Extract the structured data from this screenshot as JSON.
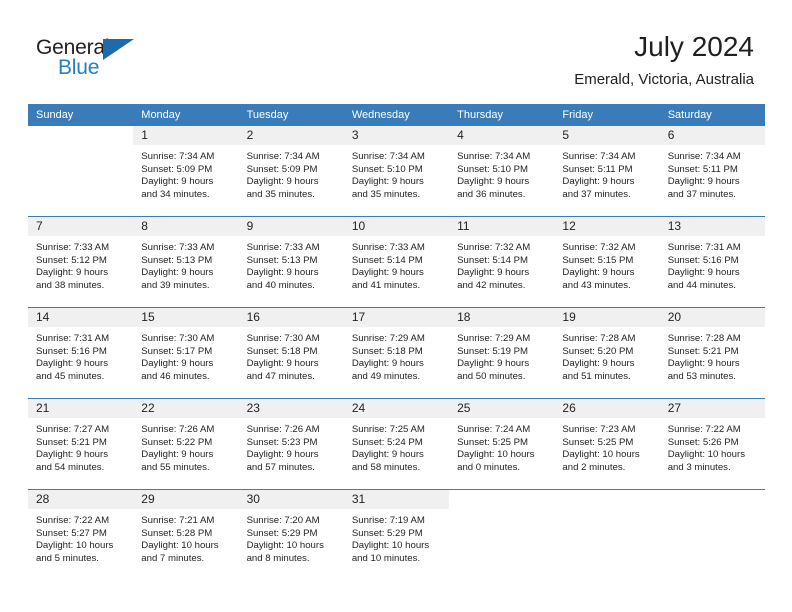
{
  "brand": {
    "name_part1": "General",
    "name_part2": "Blue",
    "triangle_color": "#1c6cad",
    "blue_color": "#2580c3"
  },
  "header": {
    "title": "July 2024",
    "location": "Emerald, Victoria, Australia"
  },
  "theme": {
    "header_bg": "#3a7cba",
    "daynum_bg": "#f0f0f0",
    "text": "#231f20"
  },
  "weekdays": [
    "Sunday",
    "Monday",
    "Tuesday",
    "Wednesday",
    "Thursday",
    "Friday",
    "Saturday"
  ],
  "weeks": [
    [
      {
        "day": "",
        "sunrise": "",
        "sunset": "",
        "daylight_line1": "",
        "daylight_line2": "",
        "blank": true
      },
      {
        "day": "1",
        "sunrise": "Sunrise: 7:34 AM",
        "sunset": "Sunset: 5:09 PM",
        "daylight_line1": "Daylight: 9 hours",
        "daylight_line2": "and 34 minutes."
      },
      {
        "day": "2",
        "sunrise": "Sunrise: 7:34 AM",
        "sunset": "Sunset: 5:09 PM",
        "daylight_line1": "Daylight: 9 hours",
        "daylight_line2": "and 35 minutes."
      },
      {
        "day": "3",
        "sunrise": "Sunrise: 7:34 AM",
        "sunset": "Sunset: 5:10 PM",
        "daylight_line1": "Daylight: 9 hours",
        "daylight_line2": "and 35 minutes."
      },
      {
        "day": "4",
        "sunrise": "Sunrise: 7:34 AM",
        "sunset": "Sunset: 5:10 PM",
        "daylight_line1": "Daylight: 9 hours",
        "daylight_line2": "and 36 minutes."
      },
      {
        "day": "5",
        "sunrise": "Sunrise: 7:34 AM",
        "sunset": "Sunset: 5:11 PM",
        "daylight_line1": "Daylight: 9 hours",
        "daylight_line2": "and 37 minutes."
      },
      {
        "day": "6",
        "sunrise": "Sunrise: 7:34 AM",
        "sunset": "Sunset: 5:11 PM",
        "daylight_line1": "Daylight: 9 hours",
        "daylight_line2": "and 37 minutes."
      }
    ],
    [
      {
        "day": "7",
        "sunrise": "Sunrise: 7:33 AM",
        "sunset": "Sunset: 5:12 PM",
        "daylight_line1": "Daylight: 9 hours",
        "daylight_line2": "and 38 minutes."
      },
      {
        "day": "8",
        "sunrise": "Sunrise: 7:33 AM",
        "sunset": "Sunset: 5:13 PM",
        "daylight_line1": "Daylight: 9 hours",
        "daylight_line2": "and 39 minutes."
      },
      {
        "day": "9",
        "sunrise": "Sunrise: 7:33 AM",
        "sunset": "Sunset: 5:13 PM",
        "daylight_line1": "Daylight: 9 hours",
        "daylight_line2": "and 40 minutes."
      },
      {
        "day": "10",
        "sunrise": "Sunrise: 7:33 AM",
        "sunset": "Sunset: 5:14 PM",
        "daylight_line1": "Daylight: 9 hours",
        "daylight_line2": "and 41 minutes."
      },
      {
        "day": "11",
        "sunrise": "Sunrise: 7:32 AM",
        "sunset": "Sunset: 5:14 PM",
        "daylight_line1": "Daylight: 9 hours",
        "daylight_line2": "and 42 minutes."
      },
      {
        "day": "12",
        "sunrise": "Sunrise: 7:32 AM",
        "sunset": "Sunset: 5:15 PM",
        "daylight_line1": "Daylight: 9 hours",
        "daylight_line2": "and 43 minutes."
      },
      {
        "day": "13",
        "sunrise": "Sunrise: 7:31 AM",
        "sunset": "Sunset: 5:16 PM",
        "daylight_line1": "Daylight: 9 hours",
        "daylight_line2": "and 44 minutes."
      }
    ],
    [
      {
        "day": "14",
        "sunrise": "Sunrise: 7:31 AM",
        "sunset": "Sunset: 5:16 PM",
        "daylight_line1": "Daylight: 9 hours",
        "daylight_line2": "and 45 minutes."
      },
      {
        "day": "15",
        "sunrise": "Sunrise: 7:30 AM",
        "sunset": "Sunset: 5:17 PM",
        "daylight_line1": "Daylight: 9 hours",
        "daylight_line2": "and 46 minutes."
      },
      {
        "day": "16",
        "sunrise": "Sunrise: 7:30 AM",
        "sunset": "Sunset: 5:18 PM",
        "daylight_line1": "Daylight: 9 hours",
        "daylight_line2": "and 47 minutes."
      },
      {
        "day": "17",
        "sunrise": "Sunrise: 7:29 AM",
        "sunset": "Sunset: 5:18 PM",
        "daylight_line1": "Daylight: 9 hours",
        "daylight_line2": "and 49 minutes."
      },
      {
        "day": "18",
        "sunrise": "Sunrise: 7:29 AM",
        "sunset": "Sunset: 5:19 PM",
        "daylight_line1": "Daylight: 9 hours",
        "daylight_line2": "and 50 minutes."
      },
      {
        "day": "19",
        "sunrise": "Sunrise: 7:28 AM",
        "sunset": "Sunset: 5:20 PM",
        "daylight_line1": "Daylight: 9 hours",
        "daylight_line2": "and 51 minutes."
      },
      {
        "day": "20",
        "sunrise": "Sunrise: 7:28 AM",
        "sunset": "Sunset: 5:21 PM",
        "daylight_line1": "Daylight: 9 hours",
        "daylight_line2": "and 53 minutes."
      }
    ],
    [
      {
        "day": "21",
        "sunrise": "Sunrise: 7:27 AM",
        "sunset": "Sunset: 5:21 PM",
        "daylight_line1": "Daylight: 9 hours",
        "daylight_line2": "and 54 minutes."
      },
      {
        "day": "22",
        "sunrise": "Sunrise: 7:26 AM",
        "sunset": "Sunset: 5:22 PM",
        "daylight_line1": "Daylight: 9 hours",
        "daylight_line2": "and 55 minutes."
      },
      {
        "day": "23",
        "sunrise": "Sunrise: 7:26 AM",
        "sunset": "Sunset: 5:23 PM",
        "daylight_line1": "Daylight: 9 hours",
        "daylight_line2": "and 57 minutes."
      },
      {
        "day": "24",
        "sunrise": "Sunrise: 7:25 AM",
        "sunset": "Sunset: 5:24 PM",
        "daylight_line1": "Daylight: 9 hours",
        "daylight_line2": "and 58 minutes."
      },
      {
        "day": "25",
        "sunrise": "Sunrise: 7:24 AM",
        "sunset": "Sunset: 5:25 PM",
        "daylight_line1": "Daylight: 10 hours",
        "daylight_line2": "and 0 minutes."
      },
      {
        "day": "26",
        "sunrise": "Sunrise: 7:23 AM",
        "sunset": "Sunset: 5:25 PM",
        "daylight_line1": "Daylight: 10 hours",
        "daylight_line2": "and 2 minutes."
      },
      {
        "day": "27",
        "sunrise": "Sunrise: 7:22 AM",
        "sunset": "Sunset: 5:26 PM",
        "daylight_line1": "Daylight: 10 hours",
        "daylight_line2": "and 3 minutes."
      }
    ],
    [
      {
        "day": "28",
        "sunrise": "Sunrise: 7:22 AM",
        "sunset": "Sunset: 5:27 PM",
        "daylight_line1": "Daylight: 10 hours",
        "daylight_line2": "and 5 minutes."
      },
      {
        "day": "29",
        "sunrise": "Sunrise: 7:21 AM",
        "sunset": "Sunset: 5:28 PM",
        "daylight_line1": "Daylight: 10 hours",
        "daylight_line2": "and 7 minutes."
      },
      {
        "day": "30",
        "sunrise": "Sunrise: 7:20 AM",
        "sunset": "Sunset: 5:29 PM",
        "daylight_line1": "Daylight: 10 hours",
        "daylight_line2": "and 8 minutes."
      },
      {
        "day": "31",
        "sunrise": "Sunrise: 7:19 AM",
        "sunset": "Sunset: 5:29 PM",
        "daylight_line1": "Daylight: 10 hours",
        "daylight_line2": "and 10 minutes."
      },
      {
        "day": "",
        "sunrise": "",
        "sunset": "",
        "daylight_line1": "",
        "daylight_line2": "",
        "blank": true
      },
      {
        "day": "",
        "sunrise": "",
        "sunset": "",
        "daylight_line1": "",
        "daylight_line2": "",
        "blank": true
      },
      {
        "day": "",
        "sunrise": "",
        "sunset": "",
        "daylight_line1": "",
        "daylight_line2": "",
        "blank": true
      }
    ]
  ]
}
